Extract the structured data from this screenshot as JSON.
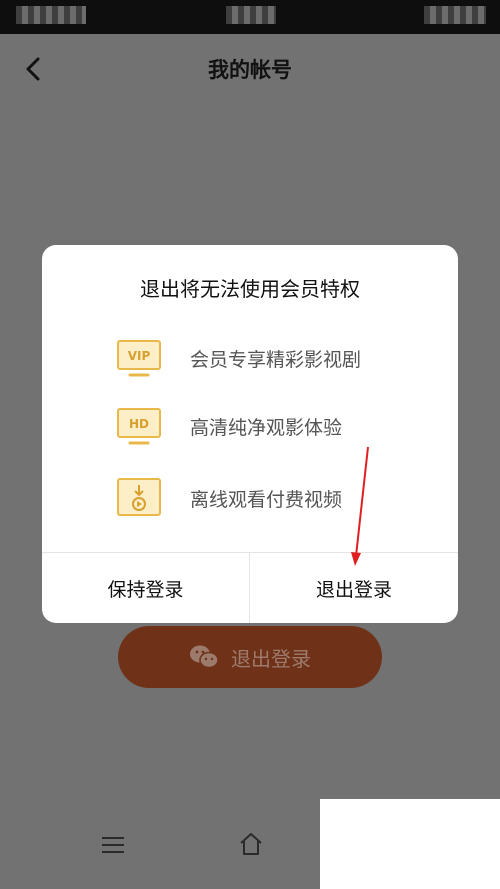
{
  "header": {
    "title": "我的帐号"
  },
  "dialog": {
    "title": "退出将无法使用会员特权",
    "features": [
      {
        "icon": "vip-screen-icon",
        "icon_text": "VIP",
        "label": "会员专享精彩影视剧"
      },
      {
        "icon": "hd-screen-icon",
        "icon_text": "HD",
        "label": "高清纯净观影体验"
      },
      {
        "icon": "offline-download-icon",
        "label": "离线观看付费视频"
      }
    ],
    "keep_label": "保持登录",
    "logout_label": "退出登录"
  },
  "page": {
    "logout_button_label": "退出登录"
  },
  "colors": {
    "accent": "#F2C94C",
    "icon_line": "#E8B84A",
    "annotation_arrow": "#E02020"
  }
}
